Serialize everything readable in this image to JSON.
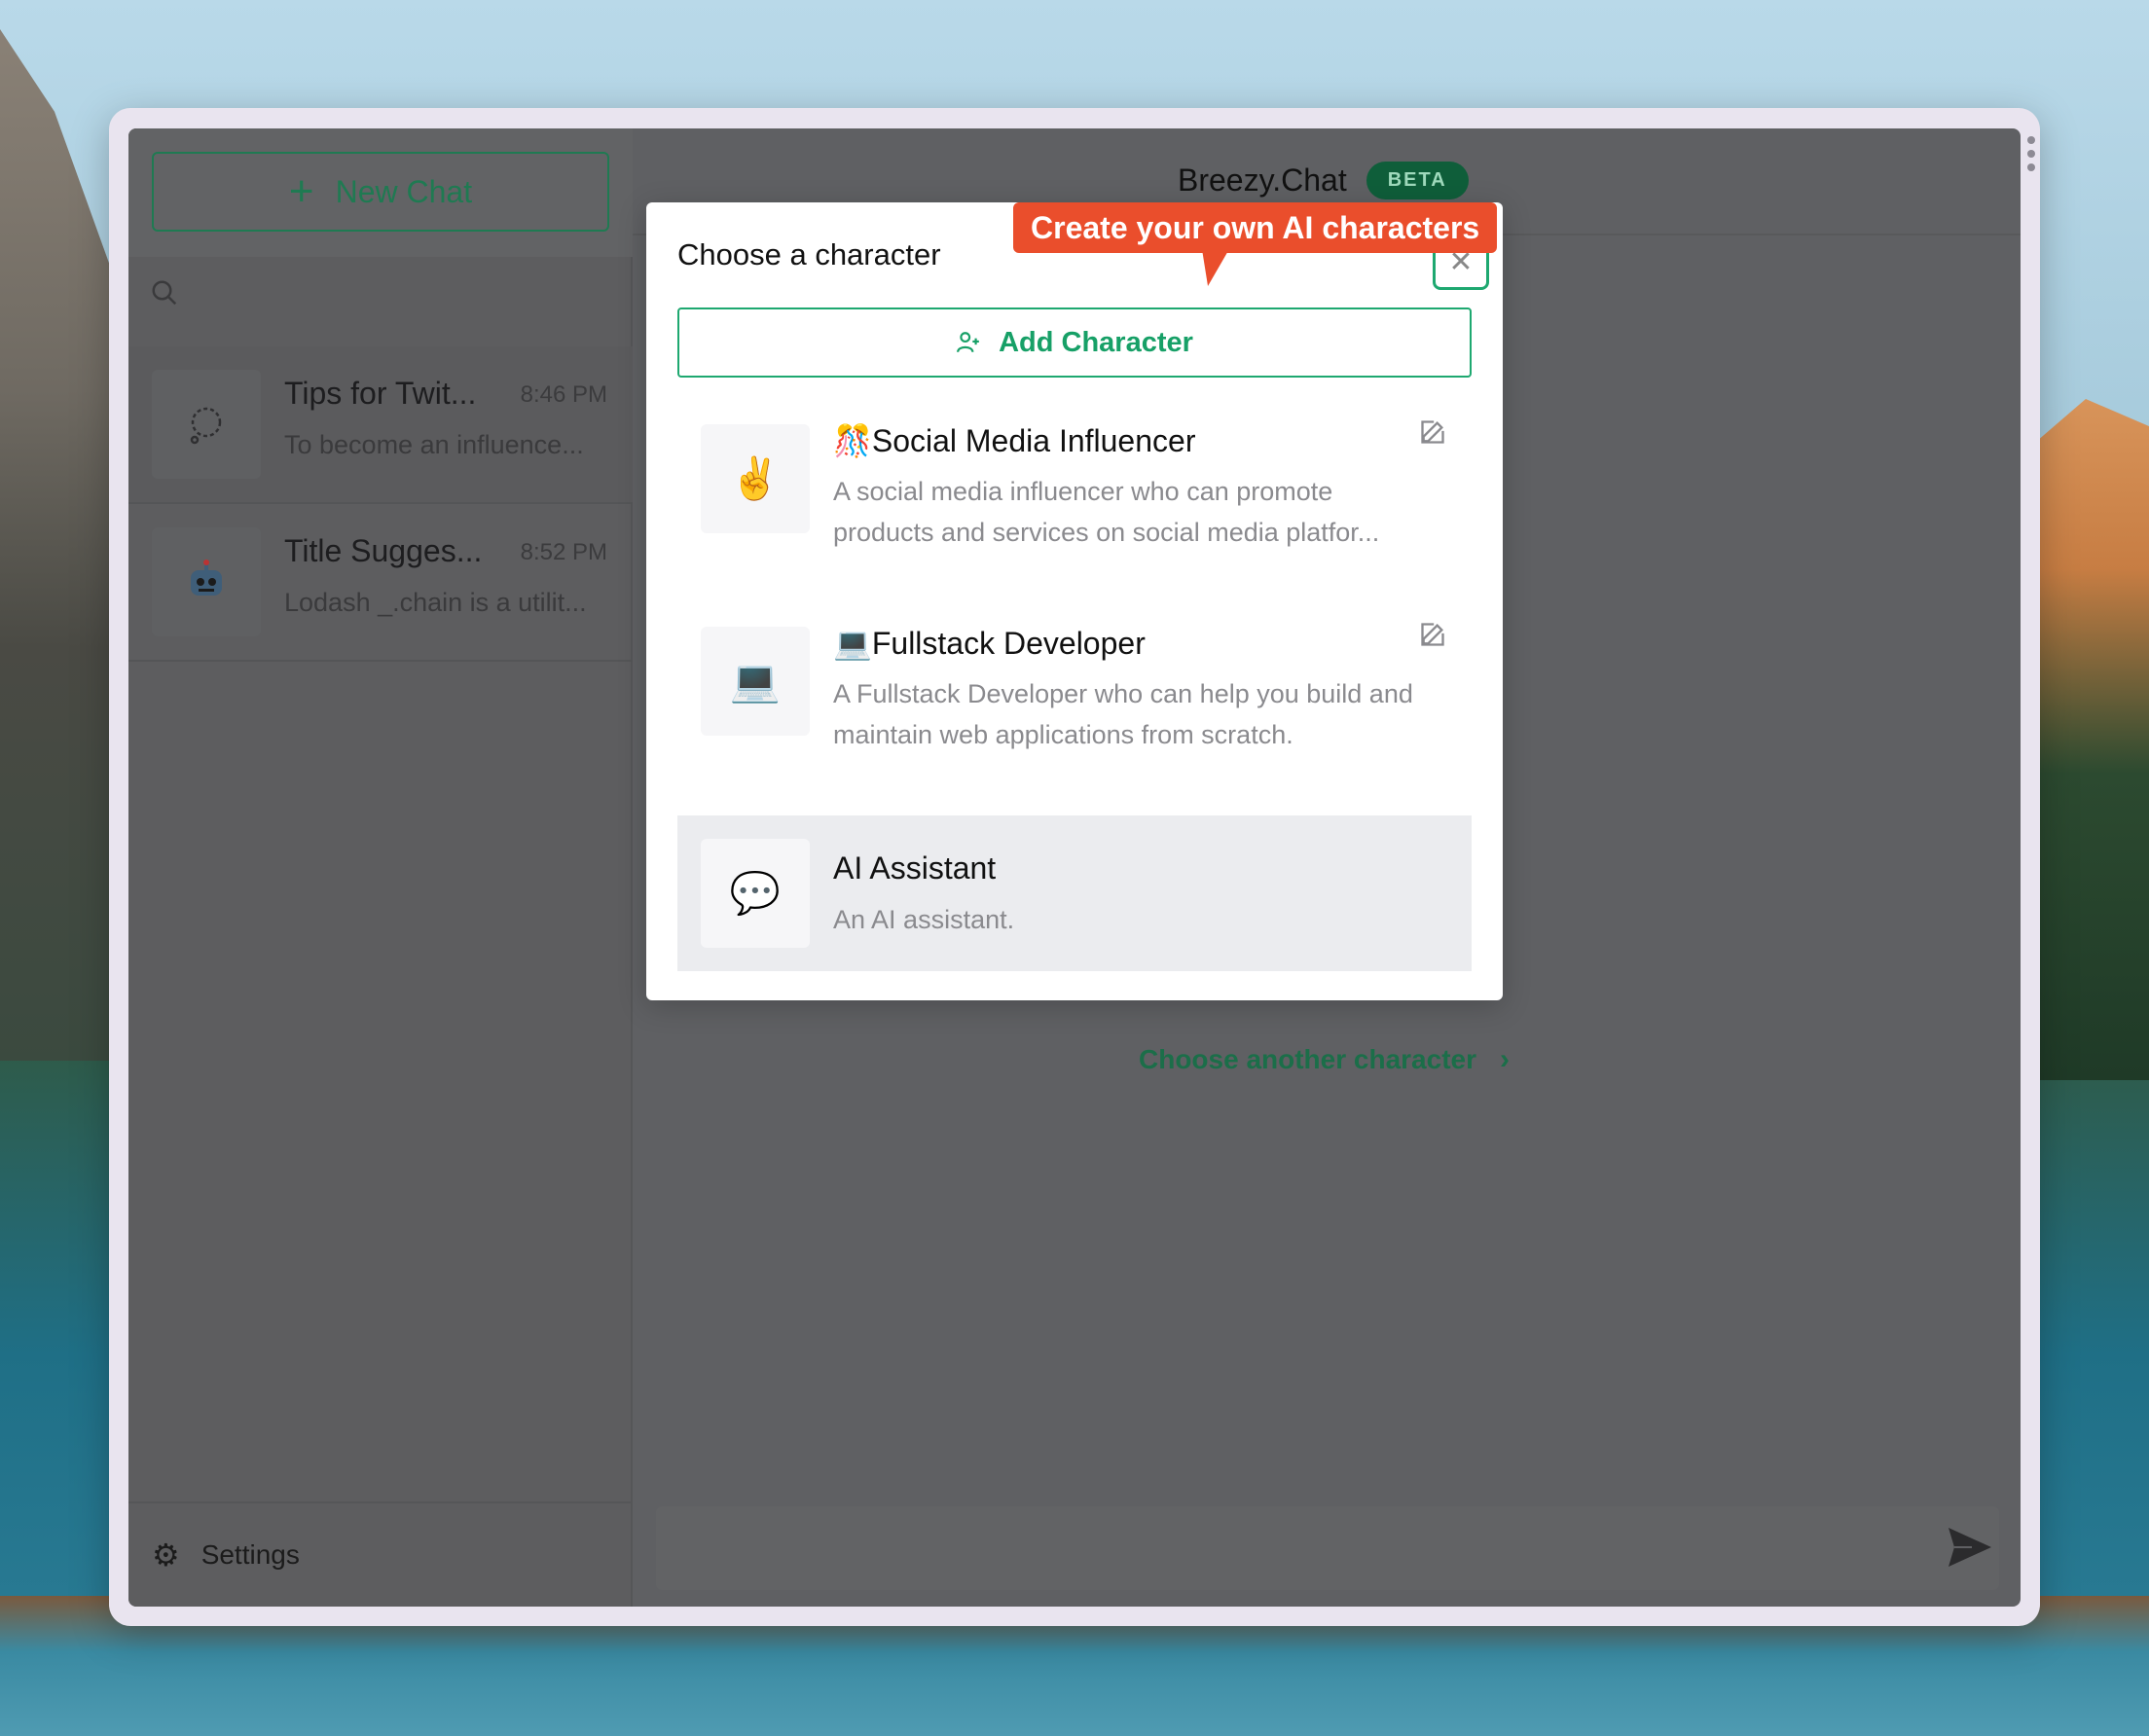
{
  "sidebar": {
    "new_chat_label": "New Chat",
    "chats": [
      {
        "title": "Tips for Twit...",
        "time": "8:46 PM",
        "preview": "To become an influence...",
        "icon": "thought-bubble-icon"
      },
      {
        "title": "Title Sugges...",
        "time": "8:52 PM",
        "preview": "Lodash _.chain is a utilit...",
        "icon": "robot-icon"
      }
    ],
    "settings_label": "Settings"
  },
  "header": {
    "brand": "Breezy.Chat",
    "badge": "BETA"
  },
  "main": {
    "choose_another_label": "Choose another character"
  },
  "modal": {
    "title": "Choose a character",
    "tooltip": "Create your own AI characters",
    "add_character_label": "Add Character",
    "characters": [
      {
        "name": "🎊Social Media Influencer",
        "avatar": "✌️",
        "description": "A social media influencer who can promote products and services on social media platfor...",
        "editable": true
      },
      {
        "name": "💻Fullstack Developer",
        "avatar": "💻",
        "description": "A Fullstack Developer who can help you build and maintain web applications from scratch.",
        "editable": true
      },
      {
        "name": "AI Assistant",
        "avatar": "💬",
        "description": "An AI assistant.",
        "editable": false,
        "selected": true
      }
    ]
  },
  "colors": {
    "accent": "#1ea870",
    "tooltip": "#ea4e2c",
    "badge_bg": "#0f5e3a"
  }
}
